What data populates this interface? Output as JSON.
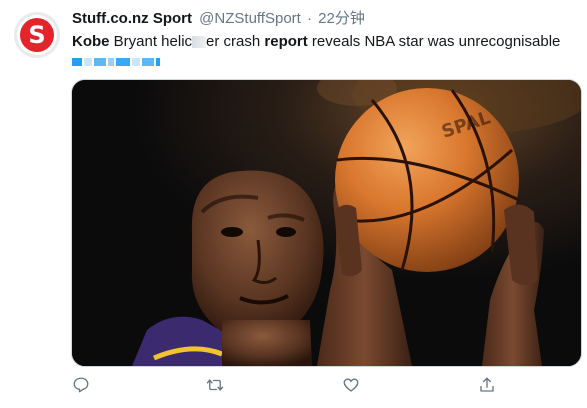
{
  "tweet": {
    "avatar_letter": "S",
    "display_name": "Stuff.co.nz Sport",
    "handle": "@NZStuffSport",
    "separator": "·",
    "time": "22分钟",
    "text_segments": [
      {
        "text": "Kobe",
        "bold": true
      },
      {
        "text": " Bryant helic",
        "bold": false
      },
      {
        "text": "   ",
        "bold": false
      },
      {
        "text": "er crash ",
        "bold": false
      },
      {
        "text": "report",
        "bold": true
      },
      {
        "text": " reveals NBA star was unrecognisable",
        "bold": false
      }
    ],
    "media_alt": "basketball-player-free-throw-photo"
  },
  "actions": [
    {
      "name": "reply-button",
      "icon": "reply-icon"
    },
    {
      "name": "retweet-button",
      "icon": "retweet-icon"
    },
    {
      "name": "like-button",
      "icon": "heart-icon"
    },
    {
      "name": "share-button",
      "icon": "share-icon"
    }
  ],
  "colors": {
    "brand_red": "#e3242b",
    "text": "#14171a",
    "secondary": "#657786",
    "action_icon": "#657786",
    "link_blue": "#1da1f2"
  }
}
